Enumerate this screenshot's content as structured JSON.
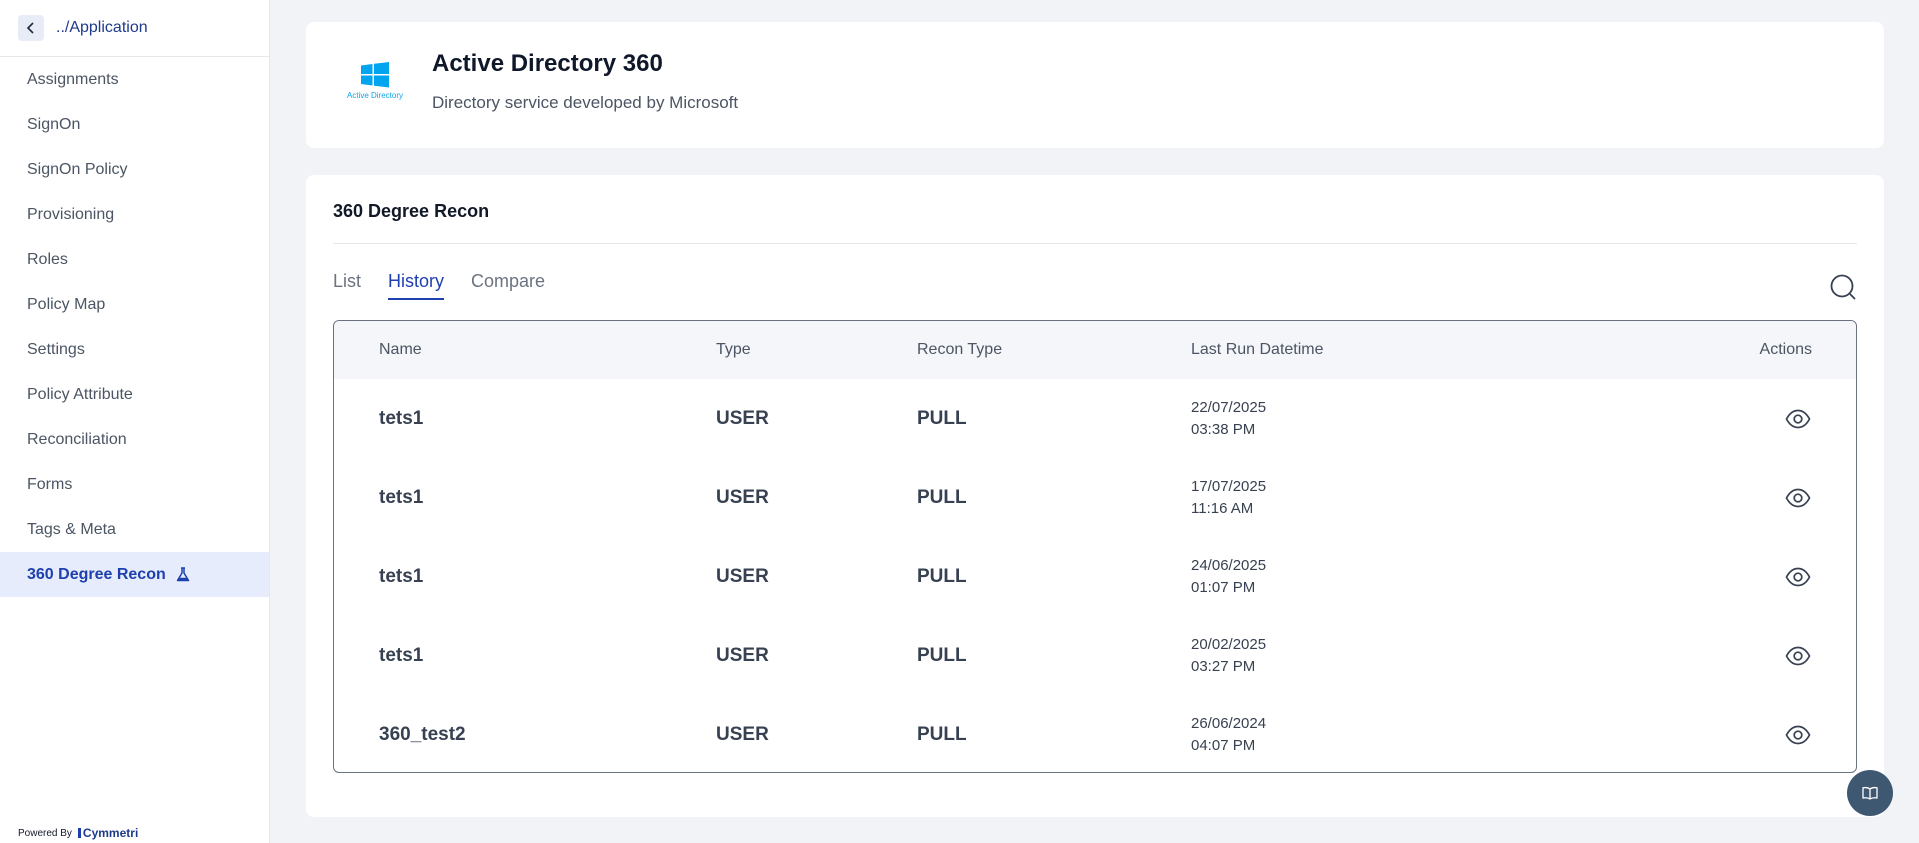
{
  "sidebar": {
    "back_label": "../Application",
    "items": [
      {
        "label": "Assignments"
      },
      {
        "label": "SignOn"
      },
      {
        "label": "SignOn Policy"
      },
      {
        "label": "Provisioning"
      },
      {
        "label": "Roles"
      },
      {
        "label": "Policy Map"
      },
      {
        "label": "Settings"
      },
      {
        "label": "Policy Attribute"
      },
      {
        "label": "Reconciliation"
      },
      {
        "label": "Forms"
      },
      {
        "label": "Tags & Meta"
      },
      {
        "label": "360 Degree Recon",
        "active": true,
        "icon": "beaker-icon"
      }
    ],
    "powered_by": "Powered By",
    "brand": "Cymmetri"
  },
  "app": {
    "title": "Active Directory 360",
    "subtitle": "Directory service developed by Microsoft",
    "logo_text": "Active Directory",
    "logo_icon": "windows-logo-icon"
  },
  "recon": {
    "section_title": "360 Degree Recon",
    "tabs": [
      {
        "label": "List"
      },
      {
        "label": "History",
        "active": true
      },
      {
        "label": "Compare"
      }
    ],
    "table": {
      "headers": {
        "name": "Name",
        "type": "Type",
        "recon_type": "Recon Type",
        "last_run": "Last Run Datetime",
        "actions": "Actions"
      },
      "rows": [
        {
          "name": "tets1",
          "type": "USER",
          "recon_type": "PULL",
          "date": "22/07/2025",
          "time": "03:38 PM"
        },
        {
          "name": "tets1",
          "type": "USER",
          "recon_type": "PULL",
          "date": "17/07/2025",
          "time": "11:16 AM"
        },
        {
          "name": "tets1",
          "type": "USER",
          "recon_type": "PULL",
          "date": "24/06/2025",
          "time": "01:07 PM"
        },
        {
          "name": "tets1",
          "type": "USER",
          "recon_type": "PULL",
          "date": "20/02/2025",
          "time": "03:27 PM"
        },
        {
          "name": "360_test2",
          "type": "USER",
          "recon_type": "PULL",
          "date": "26/06/2024",
          "time": "04:07 PM"
        }
      ]
    }
  },
  "colors": {
    "accent": "#1e40af",
    "active_bg": "#e6ecfb",
    "page_bg": "#f1f3f7",
    "fab_bg": "#3f5872"
  }
}
